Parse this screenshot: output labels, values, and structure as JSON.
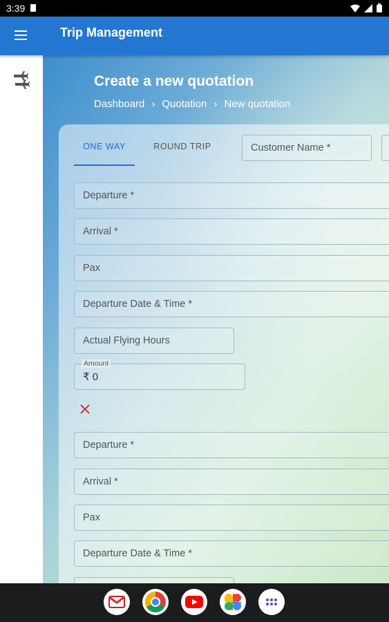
{
  "status_bar": {
    "time": "3:39"
  },
  "app_bar": {
    "title": "Trip Management"
  },
  "page": {
    "heading": "Create a new quotation",
    "breadcrumb": [
      "Dashboard",
      "Quotation",
      "New quotation"
    ]
  },
  "form": {
    "tabs": [
      {
        "label": "ONE WAY",
        "active": true
      },
      {
        "label": "ROUND TRIP",
        "active": false
      }
    ],
    "customer_name_label": "Customer Name *",
    "leg1": {
      "departure": "Departure *",
      "arrival": "Arrival *",
      "pax": "Pax",
      "departure_datetime": "Departure Date & Time *",
      "flying_hours": "Actual Flying Hours",
      "amount_label": "Amount",
      "amount_value": "₹  0"
    },
    "leg2": {
      "departure": "Departure *",
      "arrival": "Arrival *",
      "pax": "Pax",
      "departure_datetime": "Departure Date & Time *"
    }
  },
  "dock": [
    "gmail",
    "chrome",
    "youtube",
    "photos",
    "app-drawer"
  ],
  "colors": {
    "app_bar": "#2376d2",
    "accent": "#1e6fcf",
    "remove": "#d32f2f"
  }
}
